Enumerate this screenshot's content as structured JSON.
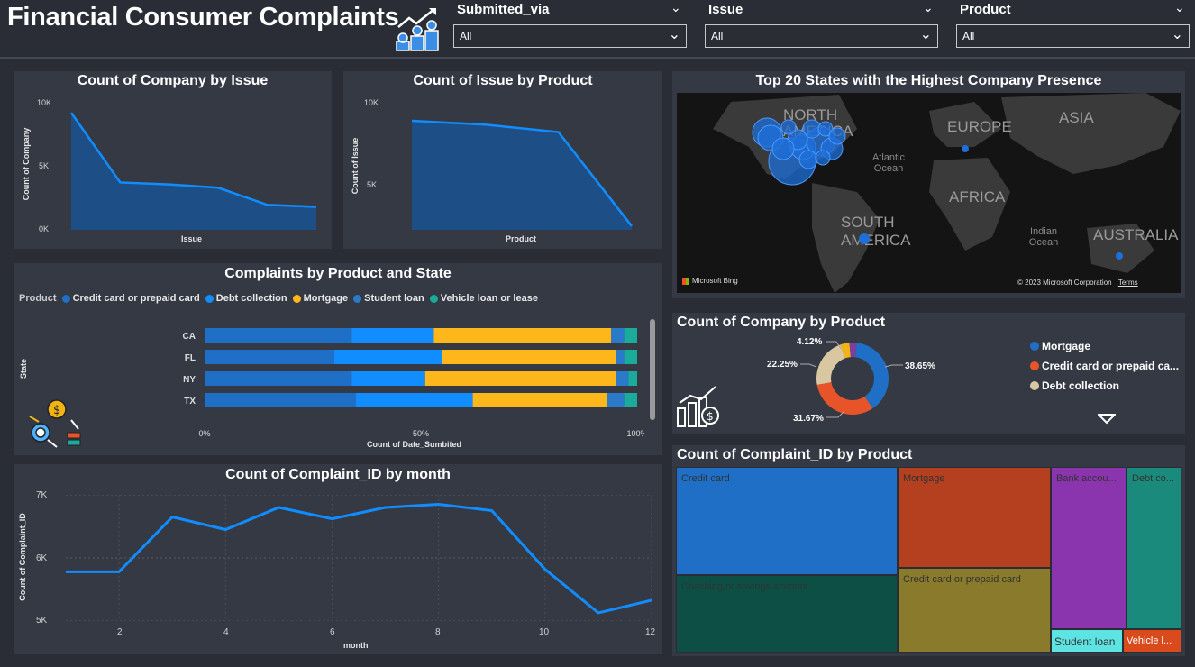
{
  "header": {
    "title": "Financial Consumer Complaints",
    "slicers": [
      {
        "label": "Submitted_via",
        "value": "All"
      },
      {
        "label": "Issue",
        "value": "All"
      },
      {
        "label": "Product",
        "value": "All"
      }
    ]
  },
  "company_by_issue": {
    "title": "Count of Company by Issue",
    "xlabel": "Issue",
    "ylabel": "Count of Company",
    "yticks": [
      "10K",
      "5K",
      "0K"
    ],
    "chart_data": {
      "type": "area",
      "values": [
        8900,
        3600,
        3450,
        3200,
        1900,
        1750
      ],
      "ylim": [
        0,
        10000
      ]
    }
  },
  "issue_by_product": {
    "title": "Count of Issue by Product",
    "xlabel": "Product",
    "ylabel": "Count of Issue",
    "yticks": [
      "10K",
      "5K"
    ],
    "chart_data": {
      "type": "area",
      "values": [
        8800,
        8600,
        8200,
        3200
      ],
      "ylim": [
        3000,
        10000
      ]
    }
  },
  "map": {
    "title": "Top 20 States with the Highest Company Presence",
    "labels": [
      "NORTH AMERICA",
      "EUROPE",
      "ASIA",
      "Atlantic Ocean",
      "AFRICA",
      "SOUTH AMERICA",
      "Indian Ocean",
      "AUSTRALIA"
    ],
    "bing": "Microsoft Bing",
    "copyright": "© 2023 Microsoft Corporation",
    "terms": "Terms"
  },
  "complaints_by_state": {
    "title": "Complaints by Product and State",
    "legend_title": "Product",
    "xlabel": "Count of Date_Sumbited",
    "ylabel": "State",
    "xticks": [
      "0%",
      "50%",
      "100%"
    ],
    "chart_data": {
      "type": "bar",
      "categories": [
        "CA",
        "FL",
        "NY",
        "TX"
      ],
      "series": [
        {
          "name": "Credit card or prepaid card",
          "color": "#1f6fc7",
          "values": [
            34,
            30,
            34,
            35
          ]
        },
        {
          "name": "Debt collection",
          "color": "#118dff",
          "values": [
            19,
            25,
            17,
            27
          ]
        },
        {
          "name": "Mortgage",
          "color": "#fdb71a",
          "values": [
            41,
            40,
            44,
            31
          ]
        },
        {
          "name": "Student loan",
          "color": "#2a7ac9",
          "values": [
            3,
            2,
            3,
            4
          ]
        },
        {
          "name": "Vehicle loan or lease",
          "color": "#1aab9b",
          "values": [
            3,
            3,
            2,
            3
          ]
        }
      ]
    }
  },
  "company_by_product": {
    "title": "Count of Company by Product",
    "chart_data": {
      "type": "pie",
      "slices": [
        {
          "name": "Mortgage",
          "pct": 38.65,
          "label": "38.65%",
          "color": "#1f6fc7"
        },
        {
          "name": "Credit card or prepaid ca...",
          "pct": 31.67,
          "label": "31.67%",
          "color": "#e8542a"
        },
        {
          "name": "Debt collection",
          "pct": 22.25,
          "label": "22.25%",
          "color": "#d9c7a1"
        },
        {
          "name": "",
          "pct": 4.12,
          "label": "4.12%",
          "color": "#f2b315"
        },
        {
          "name": "",
          "pct": 3.31,
          "label": "",
          "color": "#7d3ea1"
        }
      ]
    }
  },
  "complaint_by_month": {
    "title": "Count of Complaint_ID by month",
    "xlabel": "month",
    "ylabel": "Count of Complaint_ID",
    "yticks": [
      "7K",
      "6K",
      "5K"
    ],
    "xticks": [
      "2",
      "4",
      "6",
      "8",
      "10",
      "12"
    ],
    "chart_data": {
      "type": "line",
      "x": [
        1,
        2,
        3,
        4,
        5,
        6,
        7,
        8,
        9,
        10,
        11,
        12
      ],
      "y": [
        5780,
        5780,
        6650,
        6450,
        6800,
        6620,
        6800,
        6850,
        6750,
        5820,
        5130,
        5330
      ],
      "ylim": [
        5000,
        7000
      ]
    }
  },
  "treemap": {
    "title": "Count of Complaint_ID by Product",
    "items": [
      {
        "label": "Credit card",
        "color": "#1f6fc7"
      },
      {
        "label": "Checking or savings account",
        "color": "#0d4f45"
      },
      {
        "label": "Mortgage",
        "color": "#b5401f"
      },
      {
        "label": "Credit card or prepaid card",
        "color": "#8a7a2b"
      },
      {
        "label": "Bank accou...",
        "color": "#8a35ad"
      },
      {
        "label": "Debt co...",
        "color": "#1a8a7c"
      },
      {
        "label": "Student loan",
        "color": "#5ee3e3"
      },
      {
        "label": "Vehicle l...",
        "color": "#d94a1c"
      }
    ]
  }
}
